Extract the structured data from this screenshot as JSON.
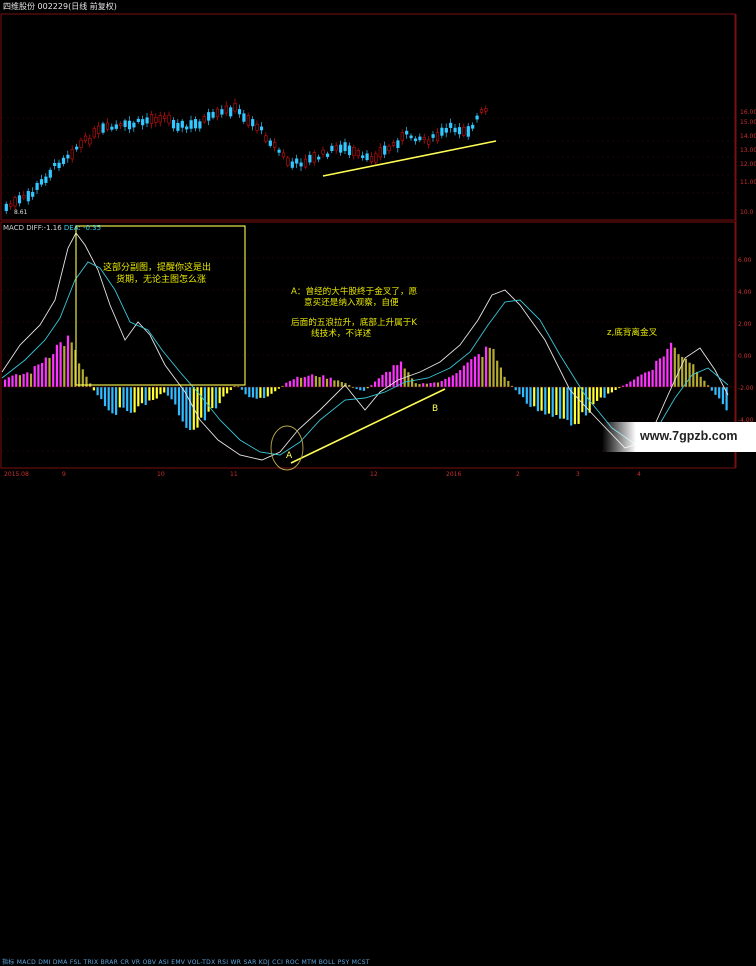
{
  "window": {
    "title": "四维股份 002229(日线 前复权)"
  },
  "indicator": {
    "name": "MACD",
    "diff_label": "DIFF:-1.16",
    "dea_label": "DEA: -0.35"
  },
  "annotations": {
    "box_note_line1": "这部分副图，提醒你这是出",
    "box_note_line2": "货期，无论主图怎么涨",
    "a_line1": "A：曾经的大牛股终于金叉了，愿",
    "a_line2": "意买还是纳入观察，自便",
    "b_line1": "后面的五浪拉升，底部上升属于K",
    "b_line2": "线技术，不详述",
    "z_note": "z,底背离金叉",
    "label_A": "A",
    "label_B": "B",
    "label_Z": "Z"
  },
  "price_axis": {
    "labels": [
      "16.00",
      "15.00",
      "14.00",
      "13.00",
      "12.00",
      "11.00",
      "10.0"
    ]
  },
  "macd_axis": {
    "labels": [
      "6.00",
      "4.00",
      "2.00",
      "0.00",
      "-2.00",
      "-4.00"
    ]
  },
  "low_label": "8.61",
  "date_axis": {
    "labels": [
      "2015.08",
      "9",
      "10",
      "11",
      "12",
      "2016",
      "2",
      "3",
      "4"
    ]
  },
  "bottom_tabs": "指标 MACD DMI DMA FSL TRIX BRAR CR VR OBV ASI EMV VOL-TDX RSI WR SAR KDJ CCI ROC MTM BOLL PSY MCST",
  "watermark": {
    "text": "www.7gpzb.com"
  },
  "colors": {
    "up": "#e0e0e0",
    "down": "#33c8ff",
    "bull_candle_edge": "#d01010",
    "macd_pos": "#ff33ff",
    "macd_pos_weak": "#b5ab32",
    "macd_neg": "#33bbff",
    "macd_neg_weak": "#ffff33",
    "diff_line": "#e6e6e6",
    "dea_line": "#39c6d8",
    "trend": "#ffff55",
    "box": "#ffff55"
  }
}
